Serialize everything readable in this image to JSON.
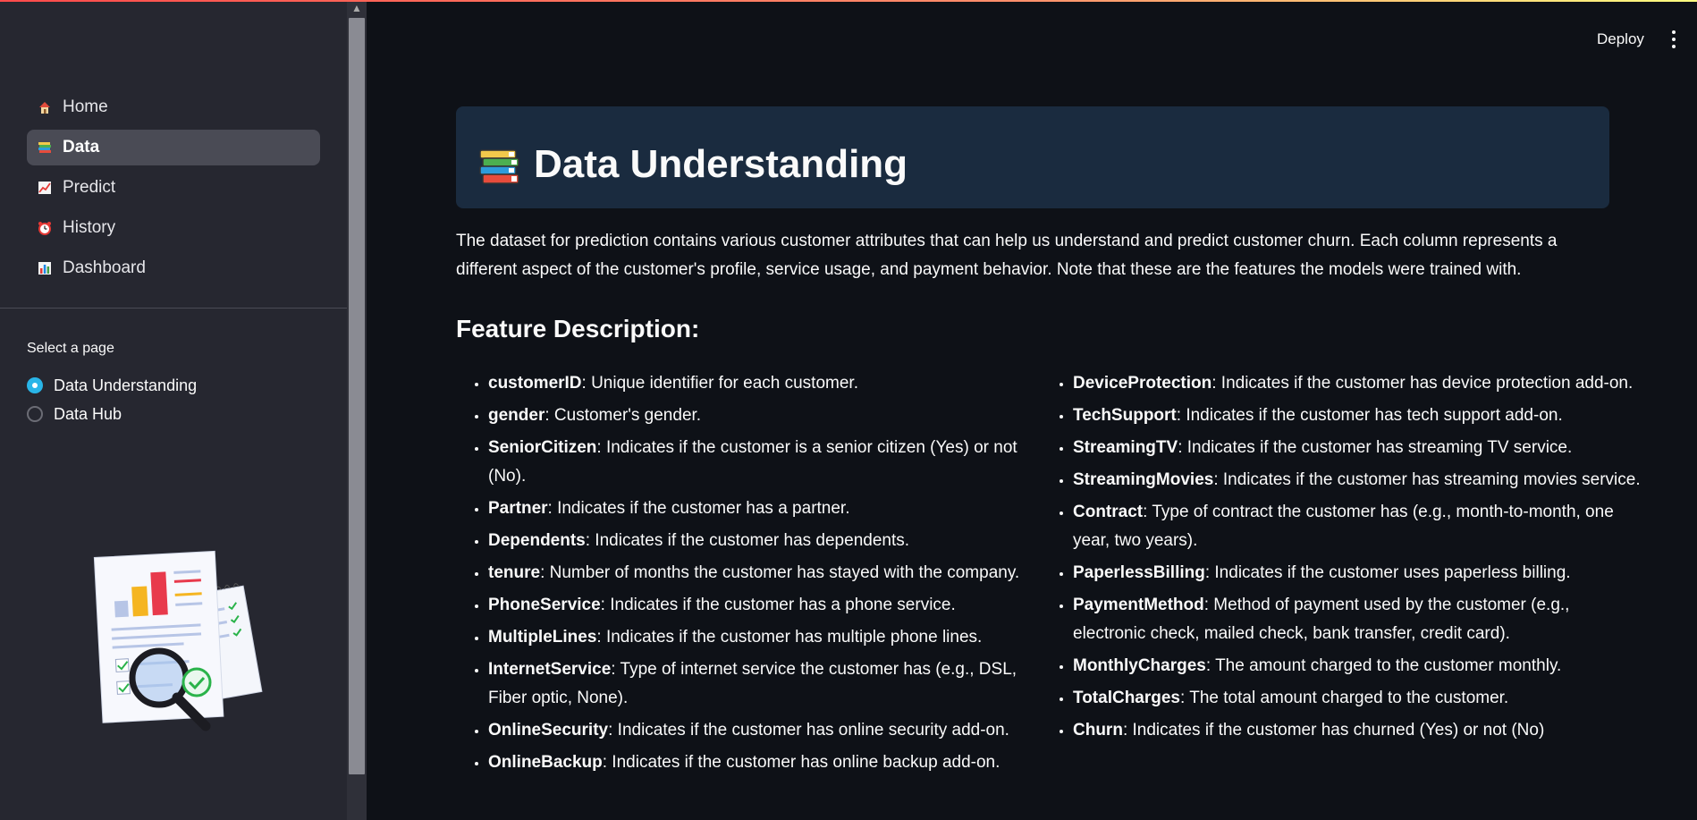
{
  "header": {
    "deploy_label": "Deploy"
  },
  "sidebar": {
    "nav": [
      {
        "label": "Home",
        "icon": "house-icon"
      },
      {
        "label": "Data",
        "icon": "books-icon",
        "active": true
      },
      {
        "label": "Predict",
        "icon": "chart-up-icon"
      },
      {
        "label": "History",
        "icon": "alarm-clock-icon"
      },
      {
        "label": "Dashboard",
        "icon": "bar-chart-icon"
      }
    ],
    "select_label": "Select a page",
    "radio_options": [
      {
        "label": "Data Understanding",
        "checked": true
      },
      {
        "label": "Data Hub",
        "checked": false
      }
    ]
  },
  "main": {
    "title": "Data Understanding",
    "intro": "The dataset for prediction contains various customer attributes that can help us understand and predict customer churn. Each column represents a different aspect of the customer's profile, service usage, and payment behavior. Note that these are the features the models were trained with.",
    "feature_heading": "Feature Description:",
    "features_left": [
      {
        "name": "customerID",
        "desc": ": Unique identifier for each customer."
      },
      {
        "name": "gender",
        "desc": ": Customer's gender."
      },
      {
        "name": "SeniorCitizen",
        "desc": ": Indicates if the customer is a senior citizen (Yes) or not (No)."
      },
      {
        "name": "Partner",
        "desc": ": Indicates if the customer has a partner."
      },
      {
        "name": "Dependents",
        "desc": ": Indicates if the customer has dependents."
      },
      {
        "name": "tenure",
        "desc": ": Number of months the customer has stayed with the company."
      },
      {
        "name": "PhoneService",
        "desc": ": Indicates if the customer has a phone service."
      },
      {
        "name": "MultipleLines",
        "desc": ": Indicates if the customer has multiple phone lines."
      },
      {
        "name": "InternetService",
        "desc": ": Type of internet service the customer has (e.g., DSL, Fiber optic, None)."
      },
      {
        "name": "OnlineSecurity",
        "desc": ": Indicates if the customer has online security add-on."
      },
      {
        "name": "OnlineBackup",
        "desc": ": Indicates if the customer has online backup add-on."
      }
    ],
    "features_right": [
      {
        "name": "DeviceProtection",
        "desc": ": Indicates if the customer has device protection add-on."
      },
      {
        "name": "TechSupport",
        "desc": ": Indicates if the customer has tech support add-on."
      },
      {
        "name": "StreamingTV",
        "desc": ": Indicates if the customer has streaming TV service."
      },
      {
        "name": "StreamingMovies",
        "desc": ": Indicates if the customer has streaming movies service."
      },
      {
        "name": "Contract",
        "desc": ": Type of contract the customer has (e.g., month-to-month, one year, two years)."
      },
      {
        "name": "PaperlessBilling",
        "desc": ": Indicates if the customer uses paperless billing."
      },
      {
        "name": "PaymentMethod",
        "desc": ": Method of payment used by the customer (e.g., electronic check, mailed check, bank transfer, credit card)."
      },
      {
        "name": "MonthlyCharges",
        "desc": ": The amount charged to the customer monthly."
      },
      {
        "name": "TotalCharges",
        "desc": ": The total amount charged to the customer."
      },
      {
        "name": "Churn",
        "desc": ": Indicates if the customer has churned (Yes) or not (No)"
      }
    ]
  },
  "colors": {
    "accent": "#29b5e8",
    "title_bg": "#1a2b3f",
    "sidebar_bg": "#262730",
    "page_bg": "#0e1117"
  }
}
